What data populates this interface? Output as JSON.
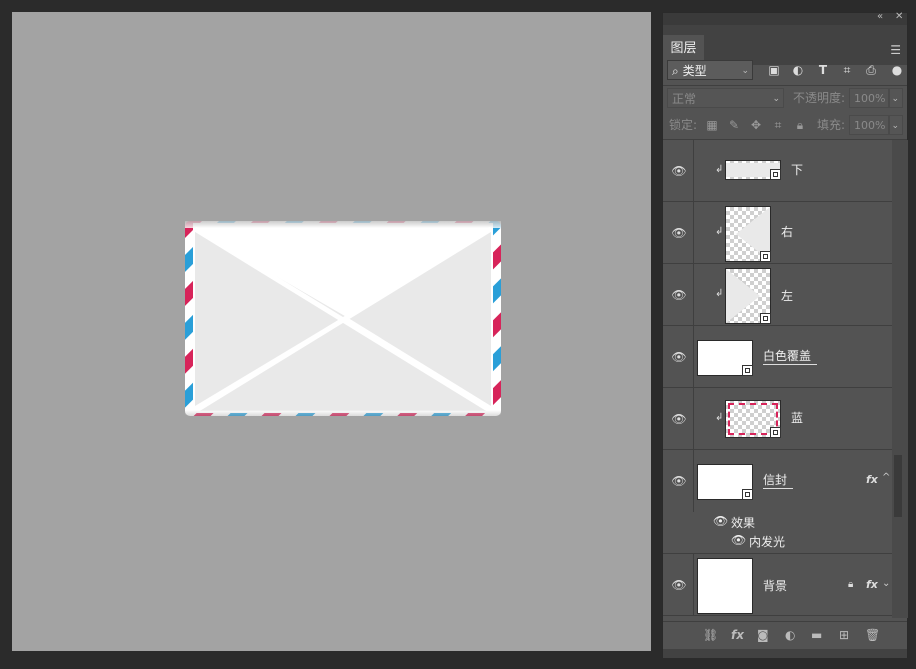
{
  "panel": {
    "tab_title": "图层",
    "filter_kind": "类型",
    "blend_mode": "正常",
    "opacity_label": "不透明度:",
    "opacity_value": "100%",
    "lock_label": "锁定:",
    "fill_label": "填充:",
    "fill_value": "100%"
  },
  "layers": [
    {
      "name": "下",
      "clipped": true,
      "visible": true
    },
    {
      "name": "右",
      "clipped": true,
      "visible": true
    },
    {
      "name": "左",
      "clipped": true,
      "visible": true
    },
    {
      "name": "白色覆盖",
      "clipped": false,
      "visible": true
    },
    {
      "name": "蓝",
      "clipped": true,
      "visible": true
    },
    {
      "name": "信封",
      "clipped": false,
      "visible": true,
      "has_fx": true,
      "effects_label": "效果",
      "effects": [
        "内发光"
      ]
    },
    {
      "name": "背景",
      "clipped": false,
      "visible": true,
      "locked": true,
      "has_fx": true
    }
  ],
  "fx_symbol": "fx",
  "colors": {
    "canvas_bg": "#a3a3a3",
    "panel_bg": "#535353",
    "stripe_red": "#d7245a",
    "stripe_blue": "#2a9fd8"
  }
}
